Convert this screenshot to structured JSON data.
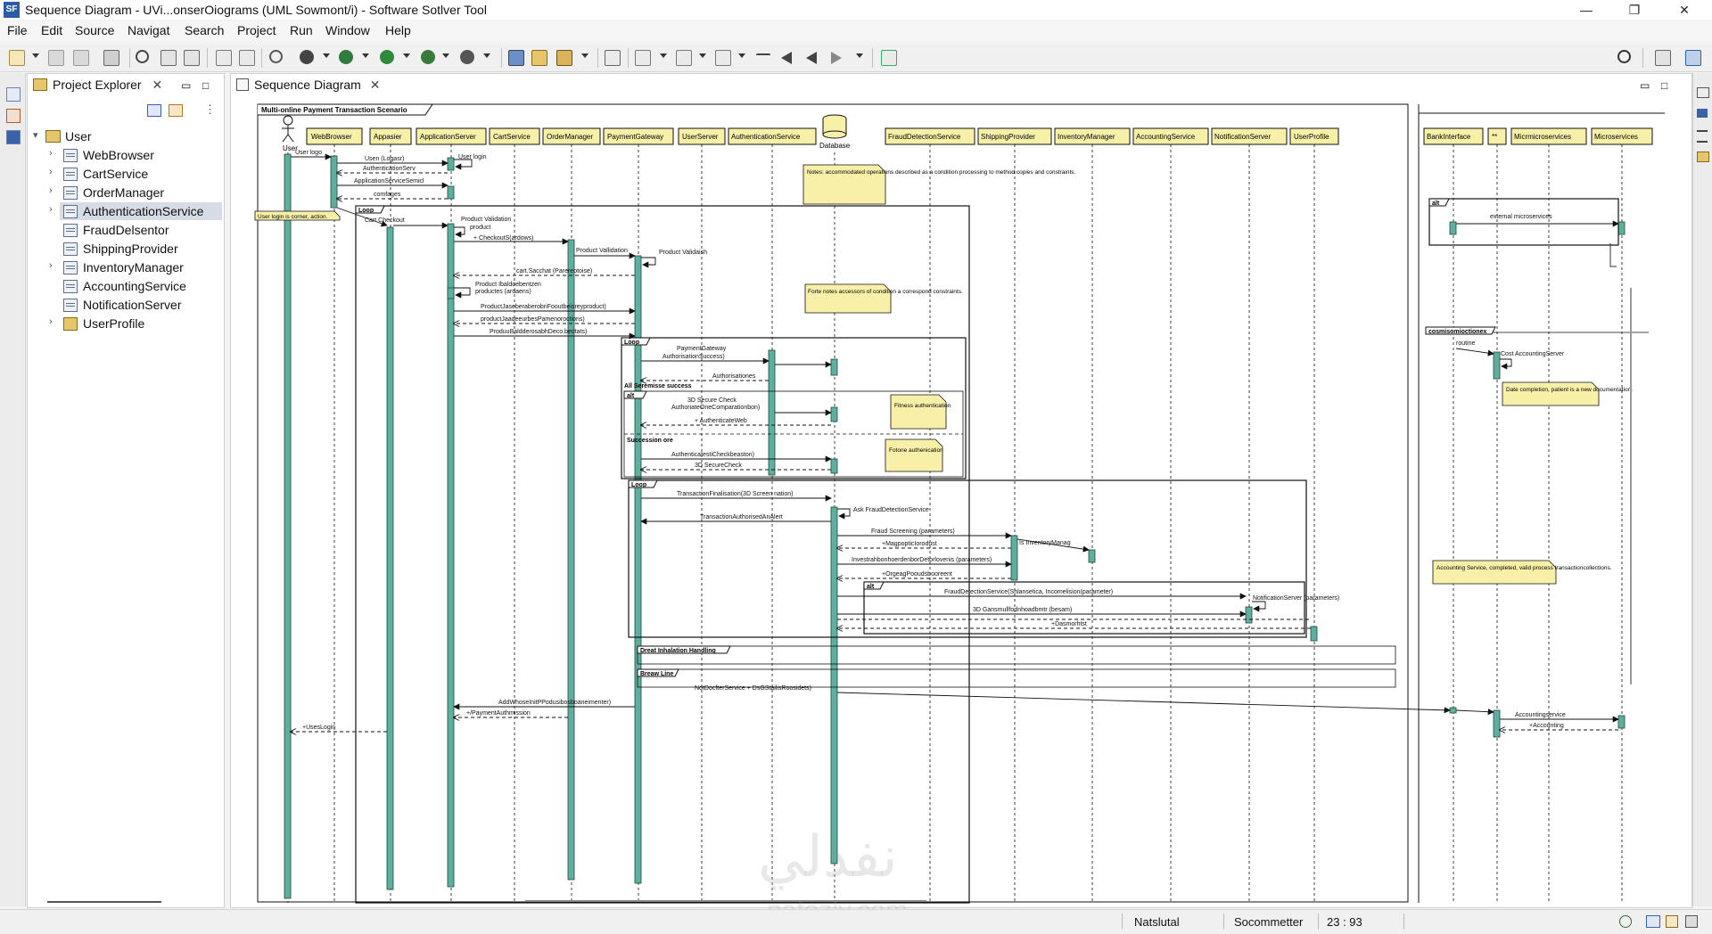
{
  "window": {
    "title": "Sequence Diagram - UVi...onserOiograms (UML Sowmont/i) - Software Sotlver Tool",
    "app_icon_label": "SF",
    "minimize": "—",
    "restore": "❐",
    "close": "✕"
  },
  "menu": [
    "File",
    "Edit",
    "Source",
    "Navigat",
    "Search",
    "Project",
    "Run",
    "Window",
    "Help"
  ],
  "project_explorer": {
    "tab_label": "Project Explorer",
    "root": "User",
    "items": [
      {
        "label": "WebBrowser",
        "expandable": true
      },
      {
        "label": "CartService",
        "expandable": true
      },
      {
        "label": "OrderManager",
        "expandable": true
      },
      {
        "label": "AuthenticationService",
        "expandable": true,
        "selected": true
      },
      {
        "label": "FraudDelsentor",
        "expandable": false
      },
      {
        "label": "ShippingProvider",
        "expandable": false
      },
      {
        "label": "InventoryManager",
        "expandable": true
      },
      {
        "label": "AccountingService",
        "expandable": false
      },
      {
        "label": "NotificationServer",
        "expandable": false
      },
      {
        "label": "UserProfile",
        "expandable": true
      }
    ]
  },
  "editor": {
    "tab_label": "Sequence Diagram"
  },
  "diagram": {
    "frame_title": "Multi-online Payment Transaction Scenario",
    "lifelines": [
      "User",
      "WebBrowser",
      "Appasier",
      "ApplicationServer",
      "CartService",
      "OrderManager",
      "PaymentGateway",
      "UserServer",
      "AuthenticationService",
      "Database",
      "FraudDetectionService",
      "ShippingProvider",
      "InventoryManager",
      "AccountingService",
      "NotificationServer",
      "UserProfile"
    ],
    "right_lifelines": [
      "BankInterface",
      "**",
      "Micrmicroservices",
      "Microservices"
    ],
    "messages": [
      "User logo",
      "User login",
      "Usen (Logasr)",
      "AuthenticationServ",
      "ApplicationServiceSemicl",
      "comfages",
      "Cart Checkout",
      "Product Validation",
      "product",
      "+ CheckoutS(ardows)",
      "Product Vallidation",
      "Product Validaish",
      "cart.Sacchat (Parereotoise)",
      "Product Ibaldoebentzen",
      "productes (ardaens)",
      "ProductJaseberaberobriFooutbeisreyproduct)",
      "productJaadeeurbesPamenoroctions)",
      "ProduuBaldderosabhDeco.bedtats)",
      "PaymentGateway",
      "AuthorisationSuccess)",
      "Authorisationes",
      "3D Secure Check",
      "AuthoriateOneComparationbon)",
      "+ AuthenticateWeb",
      "AuthenticatestiCheckbeaston)",
      "3D SecureCheck",
      "TransactionFinalisation(3D Screen nation)",
      "Ask FraudDetectionService",
      "TransactionAuthorisedAnAlert",
      "Fraud Screening (parameters)",
      "Is InventoryManag",
      "+MagpopticIorodust",
      "InvestrahbonhoerdenborDetorlovenis (parameters)",
      "+OrgeagPooudsbooreent",
      "FraudDetectionService(Shlansetica, Incomelision(parameter)",
      "NotificationServer (parameters)",
      "3D Gansmullfodnhoadbmtr (besam)",
      "+Dasmorhtst",
      "NotDocfterService + DsGStailisRoosidets)",
      "AddWhoseInitPPodusibosboaneimenter)",
      "+/PaymentAuthmission",
      "+UsesLogin",
      "external microservices",
      "routine",
      "Cost AccountingServer",
      "Accountingservice",
      "+Accounting"
    ],
    "fragments": [
      "Loop",
      "Loop",
      "All Seremisse success",
      "alt",
      "Succession ore",
      "Loop",
      "alt",
      "Dreat Inhalation Handling",
      "Breaw Line",
      "alt",
      "cosmisomioctionex"
    ],
    "notes": [
      "Notes: accommodated operations described as a condition processing to method copies and constraints.",
      "User login is corner, action.",
      "Forte notes accessors of condition a correspond constraints.",
      "Fitness authentication",
      "Fotone authenication",
      "Date completion, patient is a new documentation.",
      "Accounting Service, completed, valid process transactioncollections."
    ]
  },
  "status": {
    "field1": "Natslutal",
    "field2": "Socommetter",
    "position": "23 : 93"
  },
  "watermark": {
    "arabic": "نفذلي",
    "latin": "nafezly.com"
  }
}
